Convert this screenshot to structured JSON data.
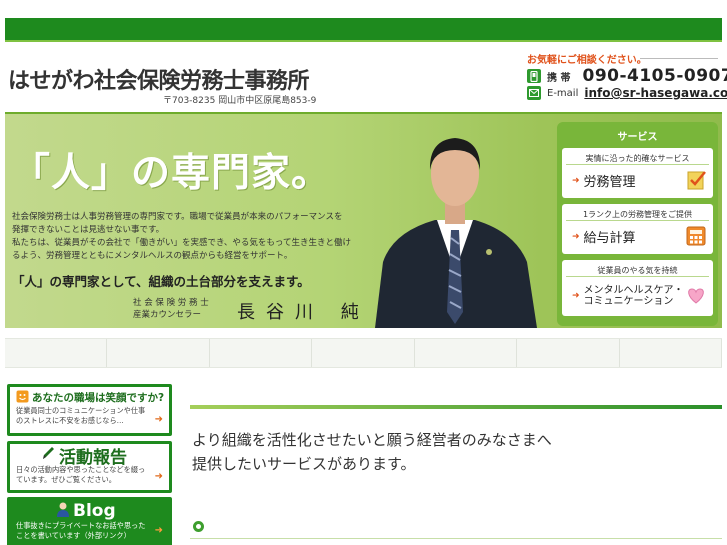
{
  "header": {
    "logo_text": "はせがわ社会保険労務士事務所",
    "address": "〒703-8235 岡山市中区原尾島853-9"
  },
  "contact": {
    "title": "お気軽にご相談ください。",
    "phone_label": "携 帯",
    "phone_number": "090-4105-0907",
    "email_label": "E-mail",
    "email_address": "info@sr-hasegawa.com"
  },
  "hero": {
    "title": "「人」の専門家。",
    "body_lines": [
      "社会保険労務士は人事労務管理の専門家です。職場で従業員が本来のパフォーマンスを",
      "発揮できないことは見逃せない事です。",
      "私たちは、従業員がその会社で「働きがい」を実感でき、やる気をもって生き生きと働け",
      "るよう、労務管理とともにメンタルヘルスの観点からも経営をサポート。"
    ],
    "tagline": "「人」の専門家として、組織の土台部分を支えます。",
    "signature_title_1": "社 会 保 険 労 務 士",
    "signature_title_2": "産業カウンセラー",
    "signature_name": "長谷川 純"
  },
  "services": {
    "heading": "サービス",
    "items": [
      {
        "top": "実情に沿った的確なサービス",
        "label": "労務管理",
        "icon": "checklist-icon"
      },
      {
        "top": "1ランク上の労務管理をご提供",
        "label": "給与計算",
        "icon": "calculator-icon"
      },
      {
        "top": "従業員のやる気を持続",
        "label": "メンタルヘルスケア・コミュニケーション",
        "icon": "heart-icon"
      }
    ]
  },
  "sidebar": {
    "banners": [
      {
        "title": "あなたの職場は笑顔ですか?",
        "desc": "従業員同士のコミュニケーションや仕事のストレスに不安をお感じなら…",
        "icon": "smiley-icon"
      },
      {
        "title": "活動報告",
        "desc": "日々の活動内容や思ったことなどを綴っています。ぜひご覧ください。",
        "icon": "pen-icon"
      },
      {
        "title": "Blog",
        "desc": "仕事抜きにプライベートなお話や思ったことを書いています（外部リンク）",
        "icon": "person-icon"
      }
    ]
  },
  "main": {
    "lead_line_1": "より組織を活性化させたいと願う経営者のみなさまへ",
    "lead_line_2": "提供したいサービスがあります。"
  },
  "colors": {
    "brand_green": "#1e8a1e",
    "light_green": "#7fc241",
    "accent_orange": "#e0521b"
  }
}
